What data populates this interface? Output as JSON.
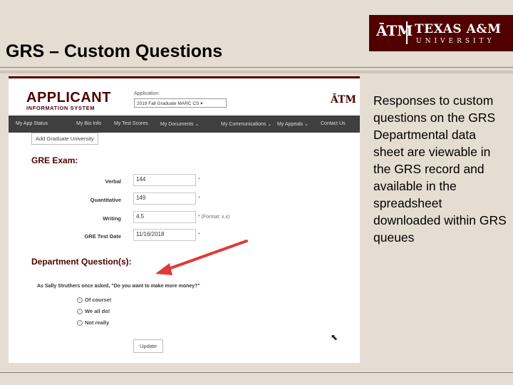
{
  "slide": {
    "title": "GRS – Custom Questions",
    "logo_mark": "ĀTM",
    "logo_name": "TEXAS A&M",
    "logo_university": "UNIVERSITY",
    "body_text": "Responses to custom questions on the GRS Departmental data sheet are viewable in the GRS record and available in the spreadsheet downloaded within GRS queues"
  },
  "app": {
    "logo_line1": "APPLICANT",
    "logo_line2": "INFORMATION SYSTEM",
    "application_label": "Application:",
    "application_value": "2019 Fall    Graduate    MARC    CS",
    "logo_small": "ĀTM"
  },
  "nav": {
    "items": [
      "My App Status",
      "My Bio Info",
      "My Test Scores",
      "My Documents ⌄",
      "My Communications ⌄",
      "My Appeals ⌄",
      "Contact Us"
    ]
  },
  "form": {
    "add_university_button": "Add Graduate University",
    "gre_heading": "GRE Exam:",
    "fields": [
      {
        "label": "Verbal",
        "value": "144",
        "note": "*"
      },
      {
        "label": "Quantitative",
        "value": "149",
        "note": "*"
      },
      {
        "label": "Writing",
        "value": "4.5",
        "note": "* (Format: x.x)"
      },
      {
        "label": "GRE Test Date",
        "value": "11/16/2018",
        "note": "*"
      }
    ],
    "dept_heading": "Department Question(s):",
    "question": "As Sally Struthers once asked, \"Do you want to make more money?\"",
    "options": [
      "Of course!",
      "We all do!",
      "Not really"
    ],
    "update_button": "Update"
  },
  "colors": {
    "maroon": "#500000",
    "slide_background": "#e6ddd2",
    "navbar": "#3f3f3f",
    "arrow": "#e03a3a"
  }
}
